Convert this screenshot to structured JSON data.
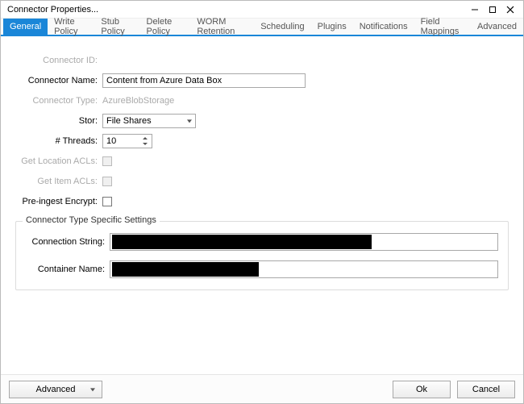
{
  "window": {
    "title": "Connector Properties..."
  },
  "tabs": [
    {
      "label": "General",
      "active": true
    },
    {
      "label": "Write Policy"
    },
    {
      "label": "Stub Policy"
    },
    {
      "label": "Delete Policy"
    },
    {
      "label": "WORM Retention"
    },
    {
      "label": "Scheduling"
    },
    {
      "label": "Plugins"
    },
    {
      "label": "Notifications"
    },
    {
      "label": "Field Mappings"
    },
    {
      "label": "Advanced"
    }
  ],
  "form": {
    "connector_id_label": "Connector ID:",
    "connector_id_value": "",
    "connector_name_label": "Connector Name:",
    "connector_name_value": "Content from Azure Data Box",
    "connector_type_label": "Connector Type:",
    "connector_type_value": "AzureBlobStorage",
    "stor_label": "Stor:",
    "stor_value": "File Shares",
    "threads_label": "# Threads:",
    "threads_value": "10",
    "get_location_acls_label": "Get Location ACLs:",
    "get_item_acls_label": "Get Item ACLs:",
    "pre_ingest_encrypt_label": "Pre-ingest Encrypt:"
  },
  "group": {
    "title": "Connector Type Specific Settings",
    "connection_string_label": "Connection String:",
    "container_name_label": "Container Name:"
  },
  "footer": {
    "advanced_label": "Advanced",
    "ok_label": "Ok",
    "cancel_label": "Cancel"
  }
}
